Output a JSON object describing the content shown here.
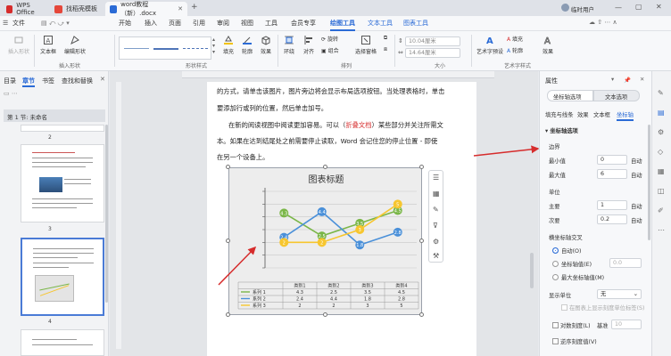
{
  "titlebar": {
    "tabs": [
      {
        "label": "WPS Office",
        "icon": "wps-logo-icon"
      },
      {
        "label": "找稻壳模板",
        "icon": "docer-icon"
      },
      {
        "label": "word教程（新）.docx",
        "icon": "word-doc-icon"
      }
    ],
    "user": "临时用户"
  },
  "menubar": {
    "items": [
      "文件",
      "开始",
      "插入",
      "页面",
      "引用",
      "审阅",
      "视图",
      "工具",
      "会员专享",
      "绘图工具",
      "文本工具",
      "图表工具"
    ],
    "selected": "绘图工具"
  },
  "ribbon": {
    "buttons": [
      "插入形状",
      "文本框",
      "编辑形状",
      "填充",
      "轮廓",
      "效果",
      "环绕",
      "对齐",
      "旋转",
      "组合",
      "选择窗格",
      "上移一层",
      "下移一层",
      "艺术字预设",
      "填充",
      "轮廓",
      "效果"
    ],
    "groups": [
      "插入形状",
      "形状样式",
      "排列",
      "大小",
      "艺术字样式"
    ],
    "height_value": "10.04厘米",
    "width_value": "14.64厘米",
    "arrange_labels": [
      "排列"
    ]
  },
  "nav": {
    "tabs": [
      "目录",
      "章节",
      "书签",
      "查找和替换"
    ],
    "active_tab": "章节",
    "section_title": "第 1 节: 未命名",
    "page_numbers": [
      "2",
      "3",
      "4"
    ]
  },
  "document": {
    "lines": [
      "的方式，请单击该图片，图片旁边将会显示布局选项按钮。当处理表格时，单击",
      "要添加行或列的位置，然后单击加号。",
      "在新的阅读视图中阅读更加容易。可以（折叠文档）某些部分并关注所需文",
      "本。如果在达到结尾处之前需要停止读取，Word 会记住您的停止位置 - 即使",
      "在另一个设备上。"
    ],
    "highlight": "折叠文档"
  },
  "chart_data": {
    "type": "line",
    "title": "图表标题",
    "categories": [
      "类别1",
      "类别2",
      "类别3",
      "类别4"
    ],
    "series": [
      {
        "name": "系列 1",
        "values": [
          4.3,
          2.5,
          3.5,
          4.5
        ],
        "color": "#7ab648"
      },
      {
        "name": "系列 2",
        "values": [
          2.4,
          4.4,
          1.8,
          2.8
        ],
        "color": "#4a90d9"
      },
      {
        "name": "系列 3",
        "values": [
          2,
          2,
          3,
          5
        ],
        "color": "#f7c62f"
      }
    ],
    "ylim": [
      0,
      6
    ],
    "table_header": [
      "",
      "类别1",
      "类别2",
      "类别3",
      "类别4"
    ],
    "grid": true
  },
  "panel": {
    "title": "属性",
    "tabs": [
      "坐标轴选项",
      "文本选项"
    ],
    "subtabs": [
      "填充与线条",
      "效果",
      "文本框",
      "坐标轴"
    ],
    "section": "坐标轴选项",
    "bounds_label": "边界",
    "min_label": "最小值",
    "min_value": "0",
    "max_label": "最大值",
    "max_value": "6",
    "auto": "自动",
    "units_label": "单位",
    "major_label": "主要",
    "major_value": "1",
    "minor_label": "次要",
    "minor_value": "0.2",
    "cross_label": "横坐标轴交叉",
    "cross_auto": "自动(O)",
    "cross_axis_value": "坐标轴值(E)",
    "cross_axis_value_input": "0.0",
    "cross_max": "最大坐标轴值(M)",
    "display_units_label": "显示单位",
    "display_units_value": "无",
    "show_units_label": "在图表上显示刻度单位标签(S)",
    "log_scale": "对数刻度(L)",
    "base_label": "基准",
    "base_value": "10",
    "reverse": "逆序刻度值(V)"
  }
}
